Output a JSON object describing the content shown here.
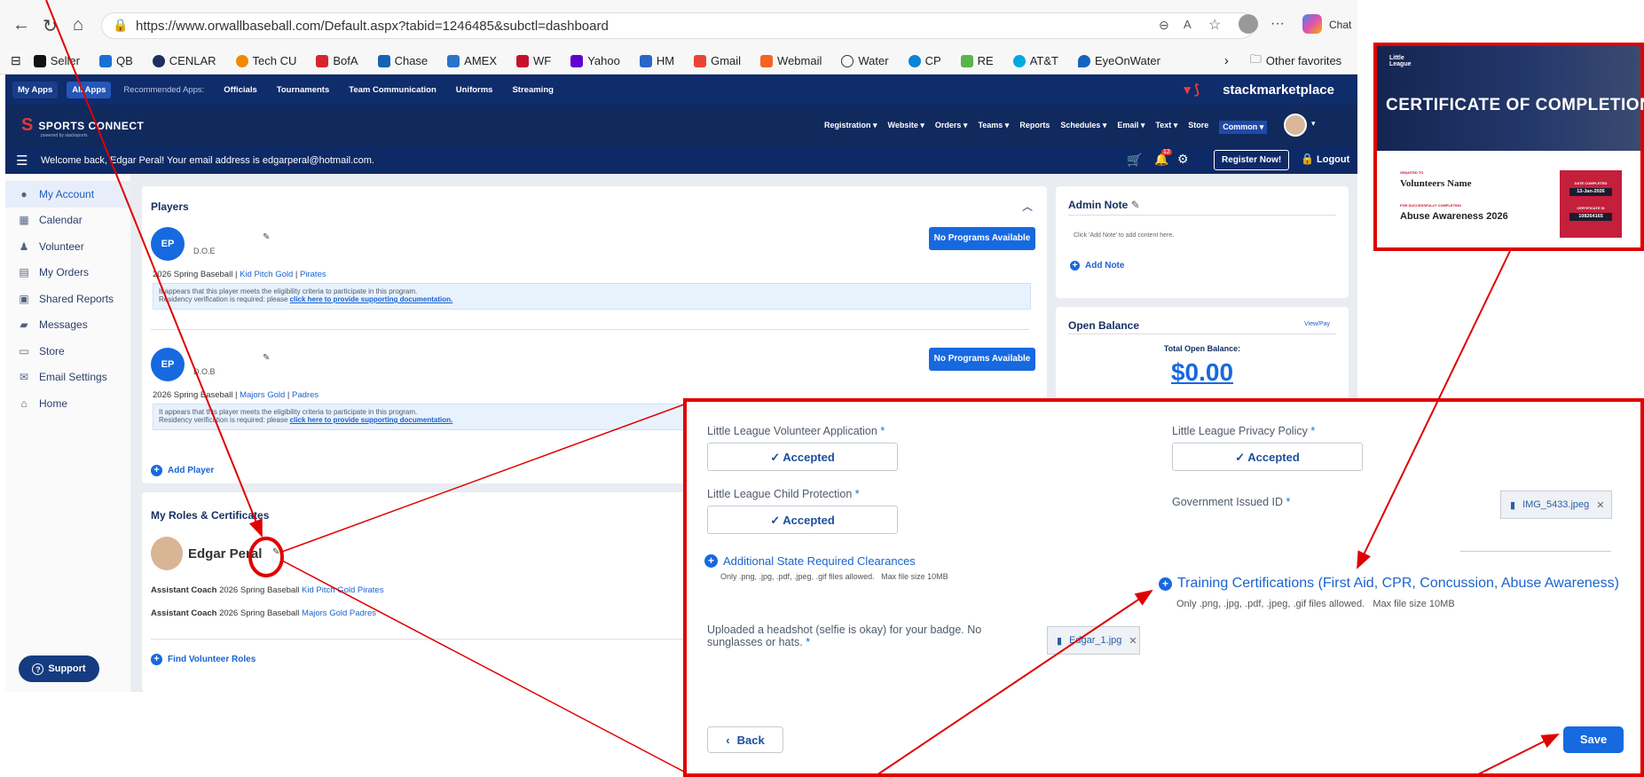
{
  "browser": {
    "url": "https://www.orwallbaseball.com/Default.aspx?tabid=1246485&subctl=dashboard",
    "chat_label": "Chat",
    "bookmarks": [
      "Seller",
      "QB",
      "CENLAR",
      "Tech CU",
      "BofA",
      "Chase",
      "AMEX",
      "WF",
      "Yahoo",
      "HM",
      "Gmail",
      "Webmail",
      "Water",
      "CP",
      "RE",
      "AT&T",
      "EyeOnWater"
    ],
    "other_favorites": "Other favorites"
  },
  "appsbar": {
    "my_apps": "My Apps",
    "all_apps": "All Apps",
    "recommended": "Recommended Apps:",
    "items": [
      "Officials",
      "Tournaments",
      "Team Communication",
      "Uniforms",
      "Streaming"
    ],
    "marketplace": "stackmarketplace"
  },
  "nav": {
    "logo": "SPORTS CONNECT",
    "logo_sub": "powered by stacksports",
    "items": [
      "Registration ▾",
      "Website ▾",
      "Orders ▾",
      "Teams ▾",
      "Reports",
      "Schedules ▾",
      "Email ▾",
      "Text ▾",
      "Store",
      "Common ▾"
    ]
  },
  "welcome": {
    "text": "Welcome back, Edgar Peral! Your email address is edgarperal@hotmail.com.",
    "bell_count": "12",
    "register": "Register Now!",
    "logout": "Logout"
  },
  "sidebar": {
    "items": [
      {
        "label": "My Account",
        "icon": "user-icon"
      },
      {
        "label": "Calendar",
        "icon": "calendar-icon"
      },
      {
        "label": "Volunteer",
        "icon": "person-icon"
      },
      {
        "label": "My Orders",
        "icon": "list-icon"
      },
      {
        "label": "Shared Reports",
        "icon": "report-icon"
      },
      {
        "label": "Messages",
        "icon": "chat-icon"
      },
      {
        "label": "Store",
        "icon": "store-icon"
      },
      {
        "label": "Email Settings",
        "icon": "mail-icon"
      },
      {
        "label": "Home",
        "icon": "home-icon"
      }
    ],
    "support": "Support"
  },
  "players": {
    "title": "Players",
    "list": [
      {
        "initials": "EP",
        "dob": "D.O.E",
        "program": "2026 Spring Baseball",
        "division": "Kid Pitch Gold",
        "team": "Pirates",
        "button": "No Programs Available"
      },
      {
        "initials": "EP",
        "dob": "D.O.B",
        "program": "2026 Spring Baseball",
        "division": "Majors Gold",
        "team": "Padres",
        "button": "No Programs Available"
      }
    ],
    "note_line1": "It appears that this player meets the eligibility criteria to participate in this program.",
    "note_line2": "Residency verification is required: please",
    "note_link": "click here to provide supporting documentation.",
    "add_player": "Add Player"
  },
  "roles": {
    "title": "My Roles & Certificates",
    "name": "Edgar Peral",
    "role1_title": "Assistant Coach",
    "role1_prog": "2026 Spring Baseball",
    "role1_div": "Kid Pitch Gold",
    "role1_team": "Pirates",
    "role2_title": "Assistant Coach",
    "role2_prog": "2026 Spring Baseball",
    "role2_div": "Majors Gold",
    "role2_team": "Padres",
    "find": "Find Volunteer Roles"
  },
  "admin_note": {
    "title": "Admin Note",
    "hint": "Click 'Add Note' to add content here.",
    "add": "Add Note"
  },
  "balance": {
    "title": "Open Balance",
    "view": "View/Pay",
    "label": "Total Open Balance:",
    "amount": "$0.00"
  },
  "form": {
    "volunteer_app": "Little League Volunteer Application",
    "privacy": "Little League Privacy Policy",
    "child_protection": "Little League Child Protection",
    "gov_id": "Government Issued ID",
    "accepted": "Accepted",
    "gov_file": "IMG_5433.jpeg",
    "state_clear": "Additional State Required Clearances",
    "file_hint": "Only .png, .jpg, .pdf, .jpeg, .gif files allowed.   Max file size 10MB",
    "training": "Training Certifications (First Aid, CPR, Concussion, Abuse Awareness)",
    "headshot": "Uploaded a headshot (selfie is okay) for your badge. No sunglasses or hats.",
    "headshot_file": "Edgar_1.jpg",
    "back": "Back",
    "save": "Save",
    "required": "*"
  },
  "certificate": {
    "brand": "Little League",
    "title": "CERTIFICATE OF COMPLETION",
    "granted_to": "GRANTED TO",
    "name": "Volunteers Name",
    "for": "FOR SUCCESSFULLY COMPLETING",
    "course": "Abuse Awareness 2026",
    "date_label": "DATE COMPLETED",
    "date": "13-Jan-2026",
    "cert_label": "CERTIFICATE ID",
    "cert_id": "108264165"
  },
  "colors": {
    "annotation": "#e00000",
    "navy": "#0f2c6b",
    "accent": "#1769e0"
  }
}
